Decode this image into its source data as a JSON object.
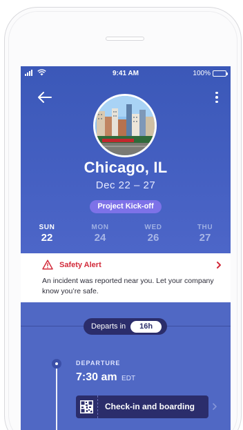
{
  "status_bar": {
    "time": "9:41 AM",
    "battery": "100%"
  },
  "header": {
    "city": "Chicago, IL",
    "date_range": "Dec 22 – 27",
    "tag": "Project Kick-off"
  },
  "days": [
    {
      "dow": "SUN",
      "num": "22",
      "active": true
    },
    {
      "dow": "MON",
      "num": "24",
      "active": false
    },
    {
      "dow": "WED",
      "num": "26",
      "active": false
    },
    {
      "dow": "THU",
      "num": "27",
      "active": false
    }
  ],
  "alert": {
    "title": "Safety Alert",
    "body": "An incident was reported near you. Let your company know you’re safe."
  },
  "departure": {
    "departs_in_label": "Departs in",
    "departs_in_value": "16h",
    "label": "DEPARTURE",
    "time": "7:30 am",
    "timezone": "EDT",
    "checkin_label": "Check-in and boarding"
  },
  "colors": {
    "hero": "#3b58b8",
    "tag": "#7d72e8",
    "alert": "#d22a3a",
    "navy": "#2b2d6b"
  },
  "icons": [
    "signal-icon",
    "wifi-icon",
    "battery-icon",
    "back-arrow-icon",
    "more-vertical-icon",
    "warning-icon",
    "chevron-right-icon",
    "qr-code-icon"
  ]
}
